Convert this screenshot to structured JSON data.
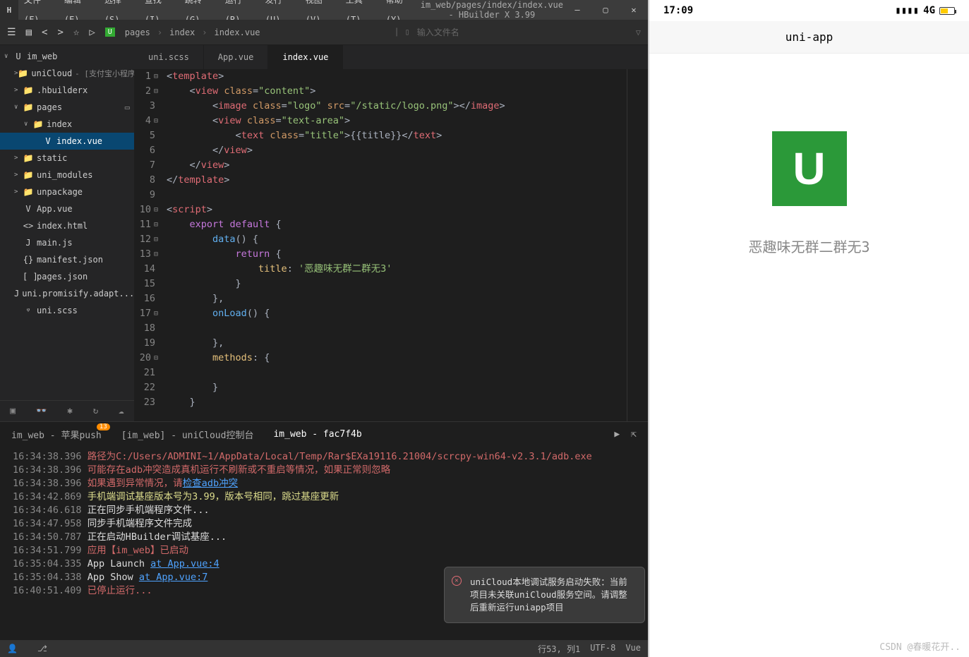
{
  "titlebar": {
    "logo": "H",
    "menus": [
      "文件(F)",
      "编辑(E)",
      "选择(S)",
      "查找(I)",
      "跳转(G)",
      "运行(R)",
      "发行(U)",
      "视图(V)",
      "工具(T)",
      "帮助(Y)"
    ],
    "title": "im_web/pages/index/index.vue - HBuilder X 3.99"
  },
  "toolbar": {
    "search_placeholder": "输入文件名",
    "breadcrumb": [
      "pages",
      "index",
      "index.vue"
    ]
  },
  "sidebar": {
    "root": "im_web",
    "items": [
      {
        "arrow": ">",
        "icon": "📁",
        "label": "uniCloud",
        "hint": "- [支付宝小程序",
        "indent": 1
      },
      {
        "arrow": ">",
        "icon": "📁",
        "label": ".hbuilderx",
        "indent": 1
      },
      {
        "arrow": "∨",
        "icon": "📁",
        "label": "pages",
        "indent": 1,
        "open": true
      },
      {
        "arrow": "∨",
        "icon": "📁",
        "label": "index",
        "indent": 2
      },
      {
        "arrow": "",
        "icon": "V",
        "label": "index.vue",
        "indent": 3,
        "selected": true
      },
      {
        "arrow": ">",
        "icon": "📁",
        "label": "static",
        "indent": 1
      },
      {
        "arrow": ">",
        "icon": "📁",
        "label": "uni_modules",
        "indent": 1
      },
      {
        "arrow": ">",
        "icon": "📁",
        "label": "unpackage",
        "indent": 1
      },
      {
        "arrow": "",
        "icon": "V",
        "label": "App.vue",
        "indent": 1
      },
      {
        "arrow": "",
        "icon": "<>",
        "label": "index.html",
        "indent": 1
      },
      {
        "arrow": "",
        "icon": "J",
        "label": "main.js",
        "indent": 1
      },
      {
        "arrow": "",
        "icon": "{}",
        "label": "manifest.json",
        "indent": 1
      },
      {
        "arrow": "",
        "icon": "[ ]",
        "label": "pages.json",
        "indent": 1
      },
      {
        "arrow": "",
        "icon": "J",
        "label": "uni.promisify.adapt...",
        "indent": 1
      },
      {
        "arrow": "",
        "icon": "ᵠ",
        "label": "uni.scss",
        "indent": 1
      }
    ]
  },
  "tabs": [
    {
      "label": "uni.scss"
    },
    {
      "label": "App.vue"
    },
    {
      "label": "index.vue",
      "active": true
    }
  ],
  "code": {
    "lines": [
      {
        "n": 1,
        "fold": "⊟",
        "html": "<span class='tok-punc'>&lt;</span><span class='tok-tag'>template</span><span class='tok-punc'>&gt;</span>"
      },
      {
        "n": 2,
        "fold": "⊟",
        "html": "    <span class='tok-punc'>&lt;</span><span class='tok-tag'>view</span> <span class='tok-attr'>class</span><span class='tok-punc'>=</span><span class='tok-str'>\"content\"</span><span class='tok-punc'>&gt;</span>"
      },
      {
        "n": 3,
        "html": "        <span class='tok-punc'>&lt;</span><span class='tok-tag'>image</span> <span class='tok-attr'>class</span><span class='tok-punc'>=</span><span class='tok-str'>\"logo\"</span> <span class='tok-attr'>src</span><span class='tok-punc'>=</span><span class='tok-str'>\"/static/logo.png\"</span><span class='tok-punc'>&gt;&lt;/</span><span class='tok-tag'>image</span><span class='tok-punc'>&gt;</span>"
      },
      {
        "n": 4,
        "fold": "⊟",
        "html": "        <span class='tok-punc'>&lt;</span><span class='tok-tag'>view</span> <span class='tok-attr'>class</span><span class='tok-punc'>=</span><span class='tok-str'>\"text-area\"</span><span class='tok-punc'>&gt;</span>"
      },
      {
        "n": 5,
        "html": "            <span class='tok-punc'>&lt;</span><span class='tok-tag'>text</span> <span class='tok-attr'>class</span><span class='tok-punc'>=</span><span class='tok-str'>\"title\"</span><span class='tok-punc'>&gt;</span><span class='tok-txt'>{{title}}</span><span class='tok-punc'>&lt;/</span><span class='tok-tag'>text</span><span class='tok-punc'>&gt;</span>"
      },
      {
        "n": 6,
        "html": "        <span class='tok-punc'>&lt;/</span><span class='tok-tag'>view</span><span class='tok-punc'>&gt;</span>"
      },
      {
        "n": 7,
        "html": "    <span class='tok-punc'>&lt;/</span><span class='tok-tag'>view</span><span class='tok-punc'>&gt;</span>"
      },
      {
        "n": 8,
        "html": "<span class='tok-punc'>&lt;/</span><span class='tok-tag'>template</span><span class='tok-punc'>&gt;</span>"
      },
      {
        "n": 9,
        "html": ""
      },
      {
        "n": 10,
        "fold": "⊟",
        "html": "<span class='tok-punc'>&lt;</span><span class='tok-tag'>script</span><span class='tok-punc'>&gt;</span>"
      },
      {
        "n": 11,
        "fold": "⊟",
        "html": "    <span class='tok-kw'>export</span> <span class='tok-kw'>default</span> <span class='tok-punc'>{</span>"
      },
      {
        "n": 12,
        "fold": "⊟",
        "html": "        <span class='tok-fn'>data</span><span class='tok-punc'>() {</span>"
      },
      {
        "n": 13,
        "fold": "⊟",
        "html": "            <span class='tok-kw'>return</span> <span class='tok-punc'>{</span>"
      },
      {
        "n": 14,
        "html": "                <span class='tok-var'>title</span><span class='tok-punc'>:</span> <span class='tok-str'>'恶趣味无群二群无3'</span>"
      },
      {
        "n": 15,
        "html": "            <span class='tok-punc'>}</span>"
      },
      {
        "n": 16,
        "html": "        <span class='tok-punc'>},</span>"
      },
      {
        "n": 17,
        "fold": "⊟",
        "html": "        <span class='tok-fn'>onLoad</span><span class='tok-punc'>() {</span>"
      },
      {
        "n": 18,
        "html": ""
      },
      {
        "n": 19,
        "html": "        <span class='tok-punc'>},</span>"
      },
      {
        "n": 20,
        "fold": "⊟",
        "html": "        <span class='tok-var'>methods</span><span class='tok-punc'>: {</span>"
      },
      {
        "n": 21,
        "html": ""
      },
      {
        "n": 22,
        "html": "        <span class='tok-punc'>}</span>"
      },
      {
        "n": 23,
        "html": "    <span class='tok-punc'>}</span>"
      }
    ]
  },
  "console": {
    "tabs": [
      {
        "label": "im_web - 苹果push",
        "badge": "13"
      },
      {
        "label": "[im_web] - uniCloud控制台"
      },
      {
        "label": "im_web - fac7f4b",
        "active": true
      }
    ],
    "logs": [
      {
        "t": "16:34:38.396",
        "cls": "log-red",
        "text": "路径为C:/Users/ADMINI~1/AppData/Local/Temp/Rar$EXa19116.21004/scrcpy-win64-v2.3.1/adb.exe"
      },
      {
        "t": "16:34:38.396",
        "cls": "log-red",
        "text": "可能存在adb冲突造成真机运行不刷新或不重启等情况，如果正常则忽略"
      },
      {
        "t": "16:34:38.396",
        "cls": "log-red",
        "text": "如果遇到异常情况，请",
        "link": "检查adb冲突"
      },
      {
        "t": "16:34:42.869",
        "cls": "log-yellow",
        "text": "手机端调试基座版本号为3.99，版本号相同，跳过基座更新"
      },
      {
        "t": "16:34:46.618",
        "cls": "log-white",
        "text": "正在同步手机端程序文件..."
      },
      {
        "t": "16:34:47.958",
        "cls": "log-white",
        "text": "同步手机端程序文件完成"
      },
      {
        "t": "16:34:50.787",
        "cls": "log-white",
        "text": "正在启动HBuilder调试基座..."
      },
      {
        "t": "16:34:51.799",
        "cls": "log-red",
        "text": "应用【im_web】已启动"
      },
      {
        "t": "16:35:04.335",
        "cls": "log-white",
        "text": "App Launch ",
        "link": "at App.vue:4"
      },
      {
        "t": "16:35:04.338",
        "cls": "log-white",
        "text": "App Show ",
        "link": "at App.vue:7"
      },
      {
        "t": "16:40:51.409",
        "cls": "log-red",
        "text": "已停止运行..."
      }
    ],
    "popup": "uniCloud本地调试服务启动失败：当前项目未关联uniCloud服务空间。请调整后重新运行uniapp项目"
  },
  "statusbar": {
    "left": "",
    "right": [
      "行53, 列1",
      "UTF-8",
      "Vue"
    ]
  },
  "phone": {
    "time": "17:09",
    "signal": "4G",
    "navbar": "uni-app",
    "title": "恶趣味无群二群无3",
    "watermark": "CSDN @春暖花开.."
  }
}
